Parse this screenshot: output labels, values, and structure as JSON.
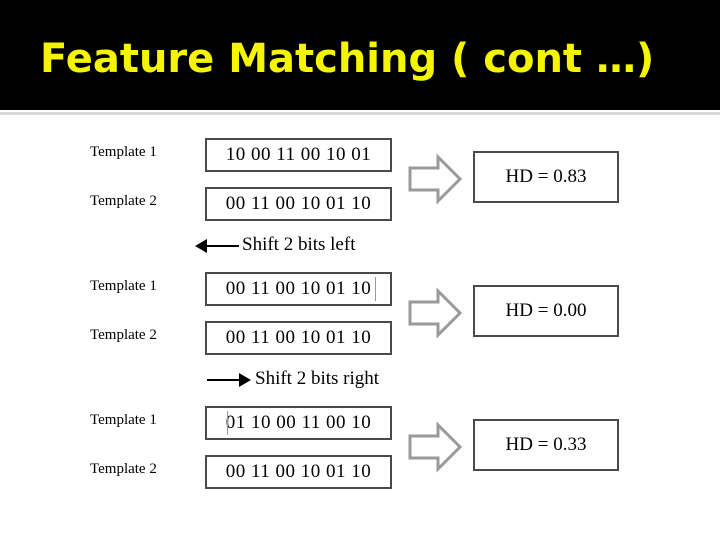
{
  "slide": {
    "title": "Feature Matching ( cont …)",
    "title_color": "#f5f500",
    "band_color": "#000000",
    "rule_color": "#d9d9d9"
  },
  "diagram": {
    "groups": [
      {
        "rows": [
          {
            "label": "Template 1",
            "bits": "10 00 11 00 10 01"
          },
          {
            "label": "Template 2",
            "bits": "00 11 00 10 01 10"
          }
        ],
        "result_label": "HD = 0.83",
        "arrow_icon": "block-arrow-right-icon"
      },
      {
        "caption": "Shift 2 bits left",
        "caption_arrow": "arrow-left-icon",
        "rows": [
          {
            "label": "Template 1",
            "bits": "00 11 00 10 01 10"
          },
          {
            "label": "Template 2",
            "bits": "00 11 00 10 01 10"
          }
        ],
        "result_label": "HD = 0.00",
        "arrow_icon": "block-arrow-right-icon"
      },
      {
        "caption": "Shift 2 bits right",
        "caption_arrow": "arrow-right-icon",
        "rows": [
          {
            "label": "Template 1",
            "bits": "01 10 00 11 00 10"
          },
          {
            "label": "Template 2",
            "bits": "00 11 00 10 01 10"
          }
        ],
        "result_label": "HD = 0.33",
        "arrow_icon": "block-arrow-right-icon"
      }
    ]
  }
}
